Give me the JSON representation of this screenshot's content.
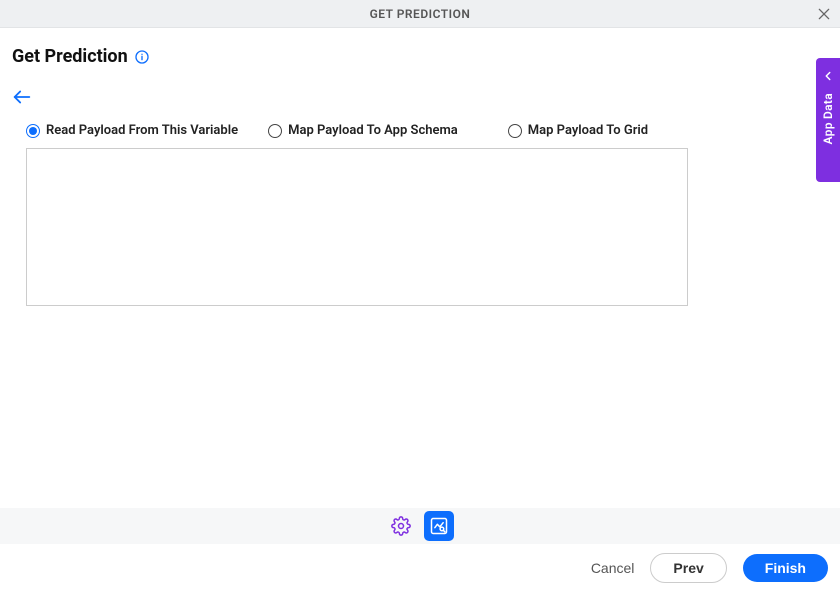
{
  "header": {
    "title": "GET PREDICTION"
  },
  "page": {
    "title": "Get Prediction"
  },
  "radios": {
    "options": [
      {
        "label": "Read Payload From This Variable",
        "selected": true
      },
      {
        "label": "Map Payload To App Schema",
        "selected": false
      },
      {
        "label": "Map Payload To Grid",
        "selected": false
      }
    ]
  },
  "textarea": {
    "value": ""
  },
  "sideTab": {
    "label": "App Data"
  },
  "footer": {
    "cancel": "Cancel",
    "prev": "Prev",
    "finish": "Finish"
  }
}
